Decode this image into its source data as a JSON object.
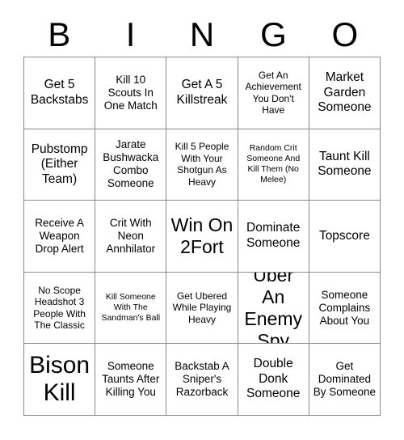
{
  "card": {
    "header_letters": [
      "B",
      "I",
      "N",
      "G",
      "O"
    ],
    "columns": 5,
    "rows": 5,
    "border_color": "#888888",
    "text_color": "#000000",
    "background_color": "#ffffff",
    "cells": [
      {
        "text": "Get 5 Backstabs",
        "size": "lg"
      },
      {
        "text": "Kill 10 Scouts In One Match",
        "size": "md"
      },
      {
        "text": "Get A 5 Killstreak",
        "size": "lg"
      },
      {
        "text": "Get An Achievement You Don't Have",
        "size": "sm"
      },
      {
        "text": "Market Garden Someone",
        "size": "lg"
      },
      {
        "text": "Pubstomp (Either Team)",
        "size": "lg"
      },
      {
        "text": "Jarate Bushwacka Combo Someone",
        "size": "md"
      },
      {
        "text": "Kill 5 People With Your Shotgun As Heavy",
        "size": "sm"
      },
      {
        "text": "Random Crit Someone And Kill Them (No Melee)",
        "size": "xs"
      },
      {
        "text": "Taunt Kill Someone",
        "size": "lg"
      },
      {
        "text": "Receive A Weapon Drop Alert",
        "size": "md"
      },
      {
        "text": "Crit With Neon Annhilator",
        "size": "md"
      },
      {
        "text": "Win On 2Fort",
        "size": "xxl"
      },
      {
        "text": "Dominate Someone",
        "size": "lg"
      },
      {
        "text": "Topscore",
        "size": "lg"
      },
      {
        "text": "No Scope Headshot 3 People With The Classic",
        "size": "sm"
      },
      {
        "text": "Kill Someone With The Sandman's Ball",
        "size": "xs"
      },
      {
        "text": "Get Ubered While Playing Heavy",
        "size": "sm"
      },
      {
        "text": "Uber An Enemy Spy",
        "size": "xxl"
      },
      {
        "text": "Someone Complains About You",
        "size": "md"
      },
      {
        "text": "Bison Kill",
        "size": "huge"
      },
      {
        "text": "Someone Taunts After Killing You",
        "size": "md"
      },
      {
        "text": "Backstab A Sniper's Razorback",
        "size": "md"
      },
      {
        "text": "Double Donk Someone",
        "size": "lg"
      },
      {
        "text": "Get Dominated By Someone",
        "size": "md"
      }
    ]
  }
}
